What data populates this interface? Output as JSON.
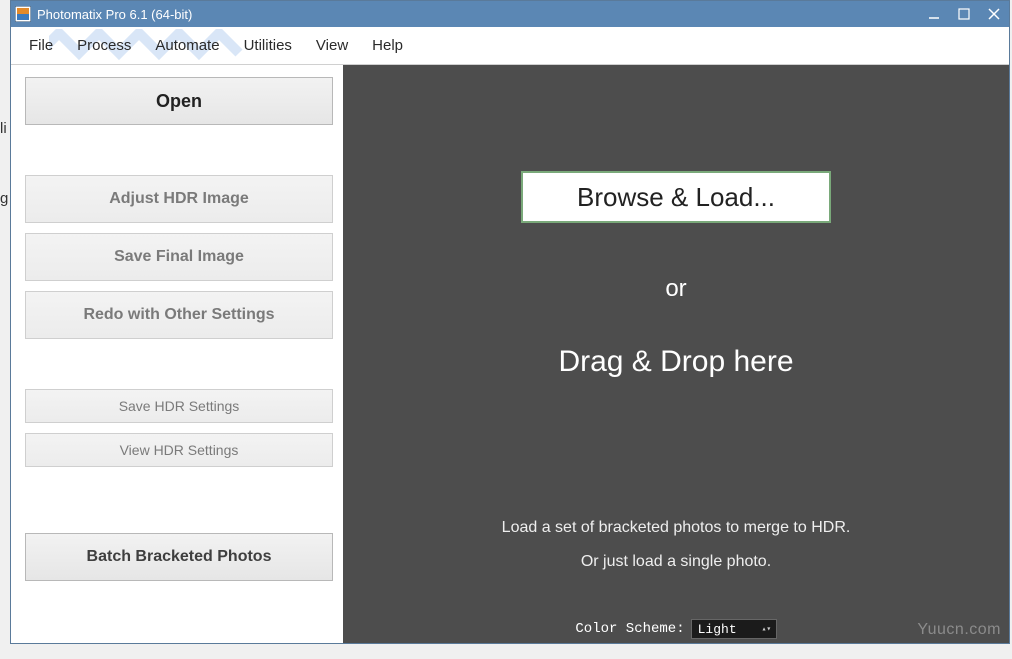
{
  "window": {
    "title": "Photomatix Pro 6.1 (64-bit)"
  },
  "menu": {
    "file": "File",
    "process": "Process",
    "automate": "Automate",
    "utilities": "Utilities",
    "view": "View",
    "help": "Help"
  },
  "sidebar": {
    "open": "Open",
    "adjust": "Adjust HDR Image",
    "save_final": "Save Final Image",
    "redo": "Redo with Other Settings",
    "save_hdr": "Save HDR Settings",
    "view_hdr": "View HDR Settings",
    "batch": "Batch Bracketed Photos"
  },
  "main": {
    "browse": "Browse & Load...",
    "or": "or",
    "drag": "Drag & Drop here",
    "hint1": "Load a set of bracketed photos to merge to HDR.",
    "hint2": "Or just load a single photo.",
    "scheme_label": "Color Scheme:",
    "scheme_value": "Light"
  },
  "watermark": "Yuucn.com",
  "edge_hint": "li",
  "edge_g": "g"
}
